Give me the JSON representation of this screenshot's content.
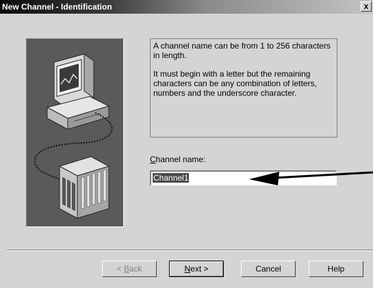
{
  "window": {
    "title": "New Channel - Identification",
    "close_glyph": "x"
  },
  "info": {
    "paragraph1": "A channel name can be from 1 to 256 characters in length.",
    "paragraph2": "It must begin with a letter but the remaining characters can be any combination of letters, numbers and the underscore character."
  },
  "channel_name": {
    "label_mnemonic": "C",
    "label_rest": "hannel name:",
    "value": "Channel1"
  },
  "buttons": {
    "back_prefix": "< ",
    "back_mnemonic": "B",
    "back_rest": "ack",
    "next_mnemonic": "N",
    "next_rest": "ext >",
    "cancel": "Cancel",
    "help": "Help"
  },
  "illustration": {
    "icons": [
      "computer-icon",
      "plc-rack-icon"
    ]
  }
}
